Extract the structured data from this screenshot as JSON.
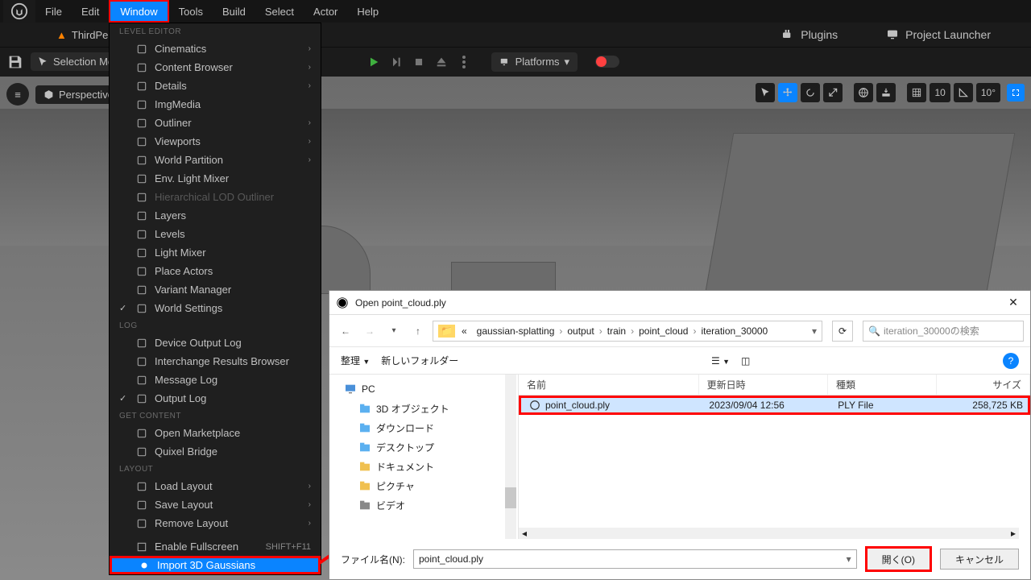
{
  "menubar": {
    "items": [
      "File",
      "Edit",
      "Window",
      "Tools",
      "Build",
      "Select",
      "Actor",
      "Help"
    ],
    "active_index": 2
  },
  "tabs": {
    "primary": "ThirdPerson"
  },
  "selection_mode": "Selection Mode",
  "right_toolbar": {
    "plugins": "Plugins",
    "launcher": "Project Launcher"
  },
  "platforms_label": "Platforms",
  "viewport": {
    "perspective": "Perspective",
    "grid_num": "10",
    "angle": "10°"
  },
  "dropdown": {
    "level_editor": "LEVEL EDITOR",
    "items_le": [
      {
        "label": "Cinematics",
        "sub": true
      },
      {
        "label": "Content Browser",
        "sub": true
      },
      {
        "label": "Details",
        "sub": true
      },
      {
        "label": "ImgMedia"
      },
      {
        "label": "Outliner",
        "sub": true
      },
      {
        "label": "Viewports",
        "sub": true
      },
      {
        "label": "World Partition",
        "sub": true
      },
      {
        "label": "Env. Light Mixer"
      },
      {
        "label": "Hierarchical LOD Outliner",
        "disabled": true
      },
      {
        "label": "Layers"
      },
      {
        "label": "Levels"
      },
      {
        "label": "Light Mixer"
      },
      {
        "label": "Place Actors"
      },
      {
        "label": "Variant Manager"
      },
      {
        "label": "World Settings",
        "checked": true
      }
    ],
    "log": "LOG",
    "items_log": [
      {
        "label": "Device Output Log"
      },
      {
        "label": "Interchange Results Browser"
      },
      {
        "label": "Message Log"
      },
      {
        "label": "Output Log",
        "checked": true
      }
    ],
    "get_content": "GET CONTENT",
    "items_gc": [
      {
        "label": "Open Marketplace"
      },
      {
        "label": "Quixel Bridge"
      }
    ],
    "layout": "LAYOUT",
    "items_layout": [
      {
        "label": "Load Layout",
        "sub": true
      },
      {
        "label": "Save Layout",
        "sub": true
      },
      {
        "label": "Remove Layout",
        "sub": true
      }
    ],
    "fullscreen": {
      "label": "Enable Fullscreen",
      "shortcut": "SHIFT+F11"
    },
    "import": "Import 3D Gaussians"
  },
  "dialog": {
    "title": "Open point_cloud.ply",
    "path": [
      "gaussian-splatting",
      "output",
      "train",
      "point_cloud",
      "iteration_30000"
    ],
    "path_prefix": "«",
    "search_placeholder": "iteration_30000の検索",
    "organize": "整理",
    "newfolder": "新しいフォルダー",
    "tree": {
      "pc": "PC",
      "items": [
        "3D オブジェクト",
        "ダウンロード",
        "デスクトップ",
        "ドキュメント",
        "ピクチャ",
        "ビデオ"
      ]
    },
    "columns": {
      "name": "名前",
      "date": "更新日時",
      "type": "種類",
      "size": "サイズ"
    },
    "row": {
      "name": "point_cloud.ply",
      "date": "2023/09/04 12:56",
      "type": "PLY File",
      "size": "258,725 KB"
    },
    "filename_label": "ファイル名(N):",
    "filename": "point_cloud.ply",
    "open": "開く(O)",
    "cancel": "キャンセル"
  }
}
